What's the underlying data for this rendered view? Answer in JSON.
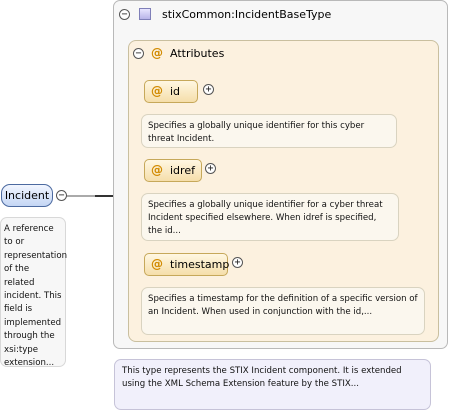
{
  "element": {
    "name": "Incident",
    "doc": "A reference to or representation of the related incident. This field is implemented through the xsi:type extension..."
  },
  "type": {
    "name": "stixCommon:IncidentBaseType",
    "doc": "This type represents the STIX Incident component. It is extended using the XML Schema Extension feature by the STIX..."
  },
  "attributes": {
    "title": "Attributes",
    "items": [
      {
        "name": "id",
        "doc": "Specifies a globally unique identifier for this cyber threat Incident."
      },
      {
        "name": "idref",
        "doc": "Specifies a globally unique identifier for a cyber threat Incident specified elsewhere. When idref is specified, the id..."
      },
      {
        "name": "timestamp",
        "doc": "Specifies a timestamp for the definition of a specific version of an Incident. When used in conjunction with the id,..."
      }
    ]
  },
  "icons": {
    "collapse": "−",
    "expand": "+",
    "attribute_symbol": "@"
  },
  "colors": {
    "element_fill": "#c4d6f4",
    "attribute_fill": "#f5deaa",
    "attributes_group_fill": "#fcf1df",
    "type_doc_fill": "#f1f0fb"
  }
}
